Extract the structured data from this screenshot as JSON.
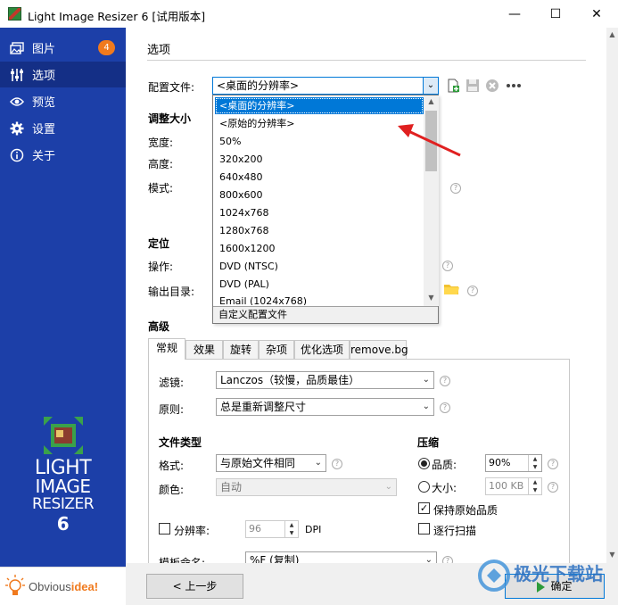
{
  "window": {
    "title": "Light Image Resizer 6  [试用版本]",
    "minimize": "—",
    "maximize": "☐",
    "close": "✕"
  },
  "sidebar": {
    "items": [
      {
        "label": "图片",
        "icon": "images-icon",
        "badge": "4"
      },
      {
        "label": "选项",
        "icon": "sliders-icon"
      },
      {
        "label": "预览",
        "icon": "eye-icon"
      },
      {
        "label": "设置",
        "icon": "gear-icon"
      },
      {
        "label": "关于",
        "icon": "info-icon"
      }
    ],
    "logo": {
      "line1": "LIGHT",
      "line2": "IMAGE",
      "line3": "RESIZER",
      "line4": "6"
    },
    "brand": {
      "prefix": "Obvious",
      "suffix": "idea!"
    }
  },
  "options": {
    "heading": "选项",
    "profile_label": "配置文件:",
    "profile_value": "<桌面的分辨率>",
    "resize_heading": "调整大小",
    "width_label": "宽度:",
    "height_label": "高度:",
    "mode_label": "模式:",
    "position_heading": "定位",
    "action_label": "操作:",
    "output_label": "输出目录:",
    "advanced_heading": "高级"
  },
  "dropdown": {
    "items": [
      "<桌面的分辨率>",
      "<原始的分辨率>",
      "50%",
      "320x200",
      "640x480",
      "800x600",
      "1024x768",
      "1280x768",
      "1600x1200",
      "DVD (NTSC)",
      "DVD (PAL)",
      "Email (1024x768)"
    ],
    "selected_index": 0,
    "footer": "自定义配置文件"
  },
  "tabs": [
    "常规",
    "效果",
    "旋转",
    "杂项",
    "优化选项",
    "remove.bg"
  ],
  "general": {
    "filter_label": "滤镜:",
    "filter_value": "Lanczos（较慢，品质最佳）",
    "rule_label": "原则:",
    "rule_value": "总是重新调整尺寸",
    "filetype_heading": "文件类型",
    "format_label": "格式:",
    "format_value": "与原始文件相同",
    "color_label": "颜色:",
    "color_value": "自动",
    "compress_heading": "压缩",
    "quality_label": "品质:",
    "quality_value": "90%",
    "size_label": "大小:",
    "size_value": "100 KB",
    "keep_quality_label": "保持原始品质",
    "progressive_label": "逐行扫描",
    "resolution_label": "分辨率:",
    "resolution_value": "96",
    "dpi_label": "DPI",
    "template_label": "模板命名:",
    "template_value": "%F (复制)"
  },
  "buttons": {
    "back": "< 上一步",
    "ok": "确定"
  },
  "watermark": "极光下载站",
  "colors": {
    "sidebar": "#1c3fa8",
    "sidebar_active": "#142f86",
    "badge": "#f07a1e",
    "selection": "#0078d7"
  }
}
